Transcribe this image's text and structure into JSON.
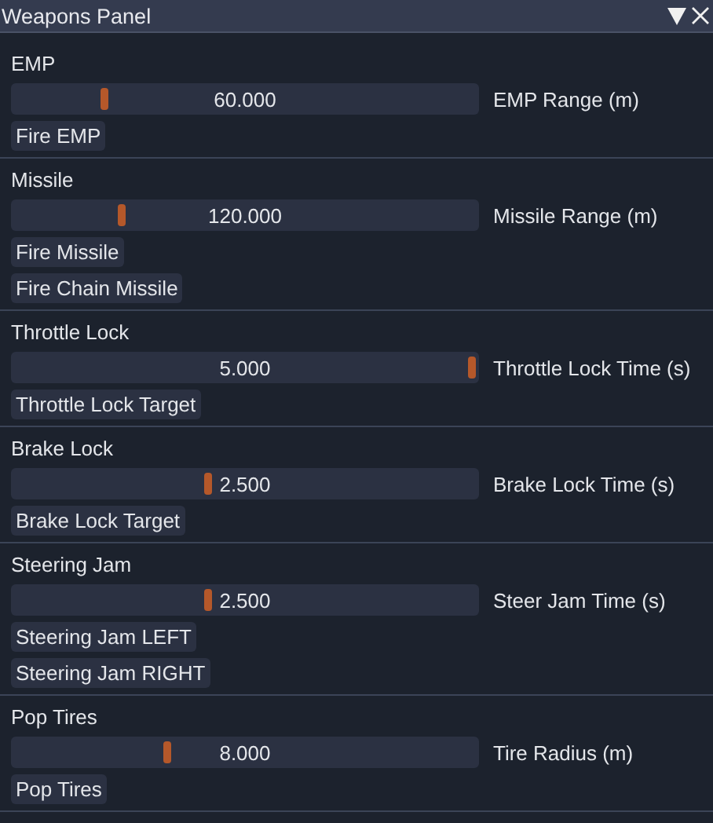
{
  "window": {
    "title": "Weapons Panel"
  },
  "sections": [
    {
      "title": "EMP",
      "slider": {
        "value": "60.000",
        "label": "EMP Range (m)",
        "level": 0.19
      },
      "buttons": [
        "Fire EMP"
      ]
    },
    {
      "title": "Missile",
      "slider": {
        "value": "120.000",
        "label": "Missile Range (m)",
        "level": 0.23
      },
      "buttons": [
        "Fire Missile",
        "Fire Chain Missile"
      ]
    },
    {
      "title": "Throttle Lock",
      "slider": {
        "value": "5.000",
        "label": "Throttle Lock Time (s)",
        "level": 1
      },
      "buttons": [
        "Throttle Lock Target"
      ]
    },
    {
      "title": "Brake Lock",
      "slider": {
        "value": "2.500",
        "label": "Brake Lock Time (s)",
        "level": 0.42
      },
      "buttons": [
        "Brake Lock Target"
      ]
    },
    {
      "title": "Steering Jam",
      "slider": {
        "value": "2.500",
        "label": "Steer Jam Time (s)",
        "level": 0.42
      },
      "buttons": [
        "Steering Jam LEFT",
        "Steering Jam RIGHT"
      ]
    },
    {
      "title": "Pop Tires",
      "slider": {
        "value": "8.000",
        "label": "Tire Radius (m)",
        "level": 0.33
      },
      "buttons": [
        "Pop Tires"
      ]
    }
  ]
}
